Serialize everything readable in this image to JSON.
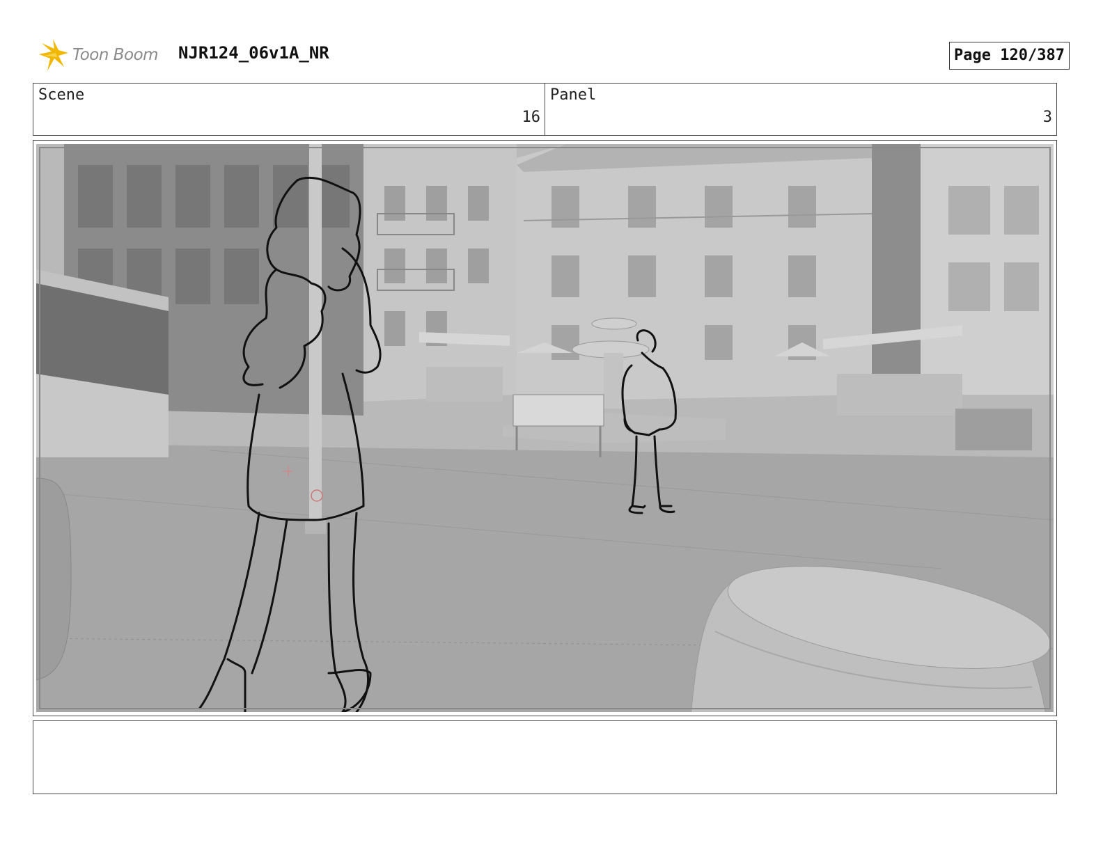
{
  "header": {
    "logo_text": "Toon Boom",
    "project_title": "NJR124_06v1A_NR",
    "page_label": "Page 120/387"
  },
  "info": {
    "scene_label": "Scene",
    "scene_value": "16",
    "panel_label": "Panel",
    "panel_value": "3"
  },
  "panel": {
    "description": "Storyboard sketch: girl walking toward a boy standing near a fountain in a town square, barrel in foreground"
  },
  "notes": {
    "text": ""
  },
  "colors": {
    "logo_accent": "#f2b800",
    "background_gray": "#a9a9a9",
    "sketch_line": "#111111"
  }
}
